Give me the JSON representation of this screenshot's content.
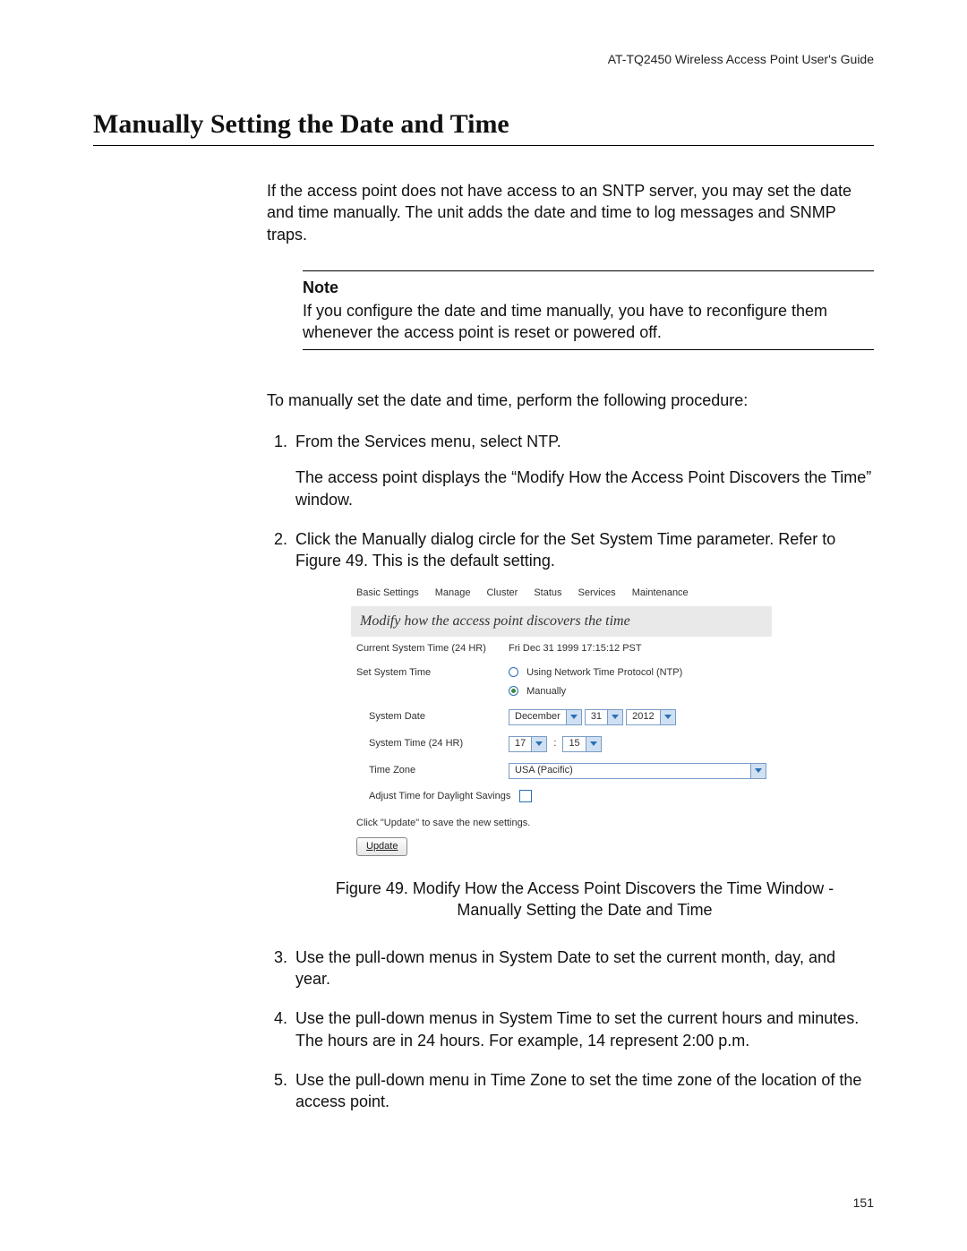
{
  "running_head": "AT-TQ2450 Wireless Access Point User's Guide",
  "h1": "Manually Setting the Date and Time",
  "intro": "If the access point does not have access to an SNTP server, you may set the date and time manually. The unit adds the date and time to log messages and SNMP traps.",
  "note": {
    "label": "Note",
    "text": "If you configure the date and time manually, you have to reconfigure them whenever the access point is reset or powered off."
  },
  "lead": "To manually set the date and time, perform the following procedure:",
  "steps": {
    "s1": "From the Services menu, select NTP.",
    "s1_sub": "The access point displays the “Modify How the Access Point Discovers the Time” window.",
    "s2": "Click the Manually dialog circle for the Set System Time parameter. Refer to Figure 49. This is the default setting.",
    "s3": "Use the pull-down menus in System Date to set the current month, day, and year.",
    "s4": "Use the pull-down menus in System Time to set the current hours and minutes. The hours are in 24 hours. For example, 14 represent 2:00 p.m.",
    "s5": "Use the pull-down menu in Time Zone to set the time zone of the location of the access point."
  },
  "ui": {
    "tabs": [
      "Basic Settings",
      "Manage",
      "Cluster",
      "Status",
      "Services",
      "Maintenance"
    ],
    "section_title": "Modify how the access point discovers the time",
    "current_time_label": "Current System Time (24 HR)",
    "current_time_value": "Fri Dec 31 1999 17:15:12 PST",
    "set_time_label": "Set System Time",
    "radio_ntp": "Using Network Time Protocol (NTP)",
    "radio_manual": "Manually",
    "system_date_label": "System Date",
    "date_month": "December",
    "date_day": "31",
    "date_year": "2012",
    "system_time_label": "System Time (24 HR)",
    "time_hour": "17",
    "time_min": "15",
    "time_sep": ":",
    "tz_label": "Time Zone",
    "tz_value": "USA (Pacific)",
    "dst_label": "Adjust Time for Daylight Savings",
    "hint": "Click \"Update\" to save the new settings.",
    "update_btn": "Update"
  },
  "figure_caption": "Figure 49. Modify How the Access Point Discovers the Time Window - Manually Setting the Date and Time",
  "page_number": "151"
}
